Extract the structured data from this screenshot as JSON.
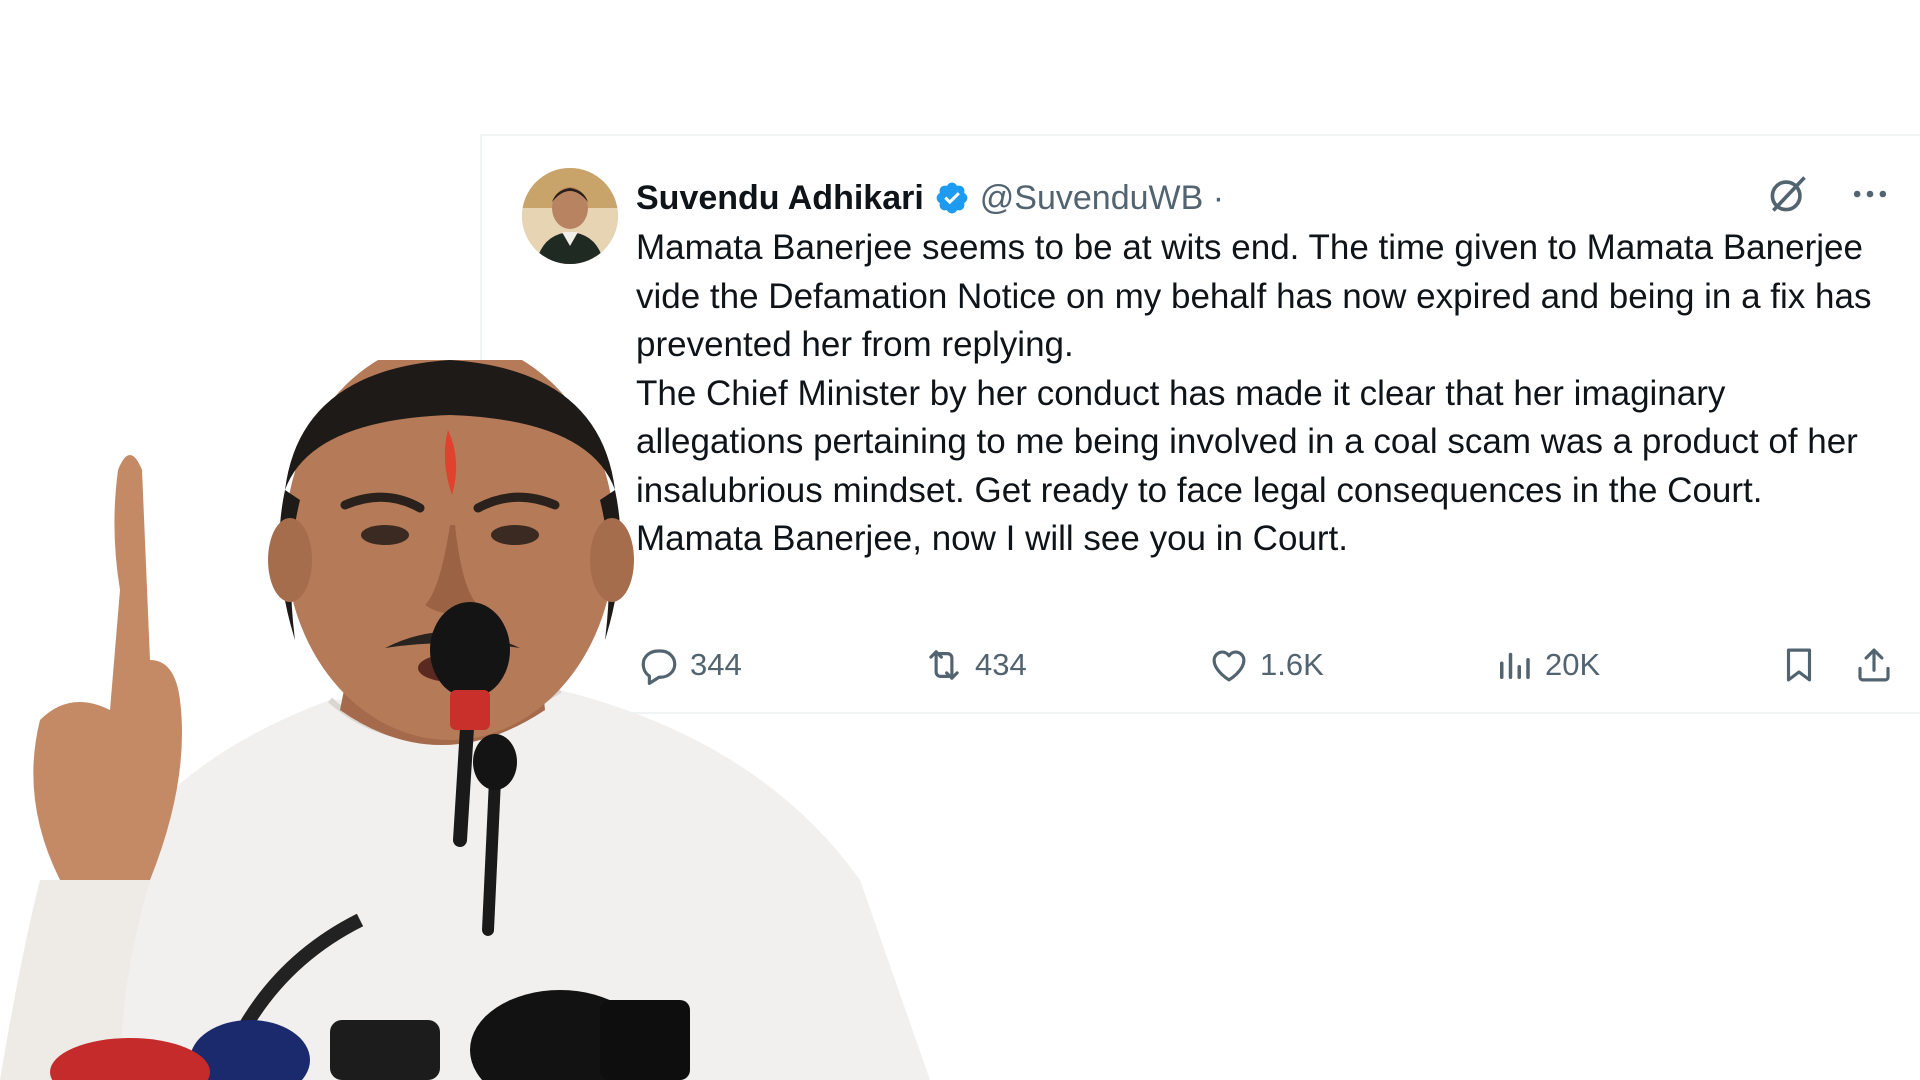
{
  "tweet": {
    "author_name": "Suvendu Adhikari",
    "author_handle": "@SuvenduWB ·",
    "verified": true,
    "paragraphs": [
      "Mamata Banerjee seems to be at wits end. The time given to Mamata Banerjee vide the Defamation Notice on my behalf has now expired and being in a fix has prevented her from replying.",
      "The Chief Minister by her conduct has made it clear that her imaginary allegations pertaining to me being involved in a coal scam was a product of her insalubrious mindset. Get ready to face legal consequences in the Court.",
      "Mamata Banerjee, now I will see you in Court."
    ],
    "stats": {
      "replies": "344",
      "reposts": "434",
      "likes": "1.6K",
      "views": "20K"
    }
  },
  "colors": {
    "text_primary": "#0f1419",
    "text_secondary": "#536471",
    "verified_blue": "#1d9bf0",
    "border": "#eff3f4"
  },
  "icons": {
    "verified": "verified-badge-icon",
    "grok": "grok-icon",
    "more": "more-dots-icon",
    "reply": "reply-bubble-icon",
    "repost": "repost-icon",
    "like": "heart-icon",
    "views": "views-bar-icon",
    "bookmark": "bookmark-icon",
    "share": "share-icon"
  }
}
